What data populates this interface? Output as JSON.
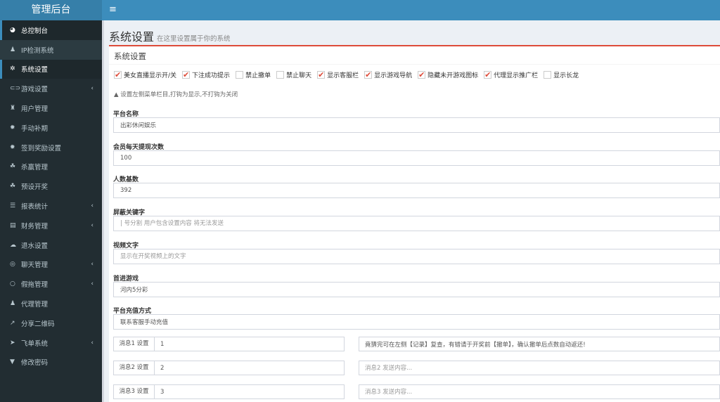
{
  "app": {
    "title": "管理后台",
    "menu_icon": "hamburger-icon"
  },
  "sidebar": {
    "items": [
      {
        "label": "总控制台",
        "icon": "dashboard-icon"
      },
      {
        "label": "IP检测系统",
        "icon": "user-plus-icon"
      },
      {
        "label": "系统设置",
        "icon": "cogs-icon"
      },
      {
        "label": "游戏设置",
        "icon": "gamepad-icon",
        "chevron": true
      },
      {
        "label": "用户管理",
        "icon": "users-icon"
      },
      {
        "label": "手动补期",
        "icon": "gear-icon"
      },
      {
        "label": "签到奖励设置",
        "icon": "gear-icon"
      },
      {
        "label": "杀赢管理",
        "icon": "cubes-icon"
      },
      {
        "label": "预设开奖",
        "icon": "cubes-icon"
      },
      {
        "label": "报表统计",
        "icon": "list-icon",
        "chevron": true
      },
      {
        "label": "财务管理",
        "icon": "database-icon",
        "chevron": true
      },
      {
        "label": "退水设置",
        "icon": "cloud-upload-icon"
      },
      {
        "label": "聊天管理",
        "icon": "comments-icon",
        "chevron": true
      },
      {
        "label": "假拖管理",
        "icon": "comment-icon",
        "chevron": true
      },
      {
        "label": "代理管理",
        "icon": "user-plus-icon"
      },
      {
        "label": "分享二维码",
        "icon": "share-icon"
      },
      {
        "label": "飞单系统",
        "icon": "paper-plane-icon",
        "chevron": true
      },
      {
        "label": "修改密码",
        "icon": "cart-icon"
      }
    ]
  },
  "page": {
    "title": "系统设置",
    "subtitle": "在这里设置属于你的系统"
  },
  "box": {
    "title": "系统设置",
    "checkboxes": [
      {
        "label": "美女直播显示开/关",
        "checked": true
      },
      {
        "label": "下注成功提示",
        "checked": true
      },
      {
        "label": "禁止撤单",
        "checked": false
      },
      {
        "label": "禁止聊天",
        "checked": false
      },
      {
        "label": "显示客服栏",
        "checked": true
      },
      {
        "label": "显示游戏导航",
        "checked": true
      },
      {
        "label": "隐藏未开游戏图标",
        "checked": true
      },
      {
        "label": "代理显示推广栏",
        "checked": true
      },
      {
        "label": "显示长龙",
        "checked": false
      }
    ],
    "note": "设置左侧菜单栏目,打钩为显示,不打钩为关闭",
    "fields": [
      {
        "label": "平台名称",
        "value": "出彩休闲娱乐",
        "placeholder": ""
      },
      {
        "label": "会员每天提现次数",
        "value": "100",
        "placeholder": ""
      },
      {
        "label": "人数基数",
        "value": "392",
        "placeholder": ""
      },
      {
        "label": "屏蔽关键字",
        "value": "",
        "placeholder": "| 号分割 用户包含设置内容 将无法发送"
      },
      {
        "label": "视频文字",
        "value": "",
        "placeholder": "显示在开奖视频上的文字"
      },
      {
        "label": "首进游戏",
        "value": "河内5分彩",
        "placeholder": ""
      },
      {
        "label": "平台充值方式",
        "value": "联系客服手动充值",
        "placeholder": ""
      }
    ],
    "messages": [
      {
        "label": "消息1 设置",
        "value": "1",
        "content": "竟猜完可在左侧【记录】复查，有错请于开奖前【撤单】，确认撤单后点数自动返还!",
        "placeholder": ""
      },
      {
        "label": "消息2 设置",
        "value": "2",
        "content": "",
        "placeholder": "消息2 发送内容..."
      },
      {
        "label": "消息3 设置",
        "value": "3",
        "content": "",
        "placeholder": "消息3 发送内容..."
      }
    ]
  },
  "colors": {
    "accent": "#3c8dbc",
    "sidebar": "#222d32",
    "danger": "#dd4b39"
  }
}
